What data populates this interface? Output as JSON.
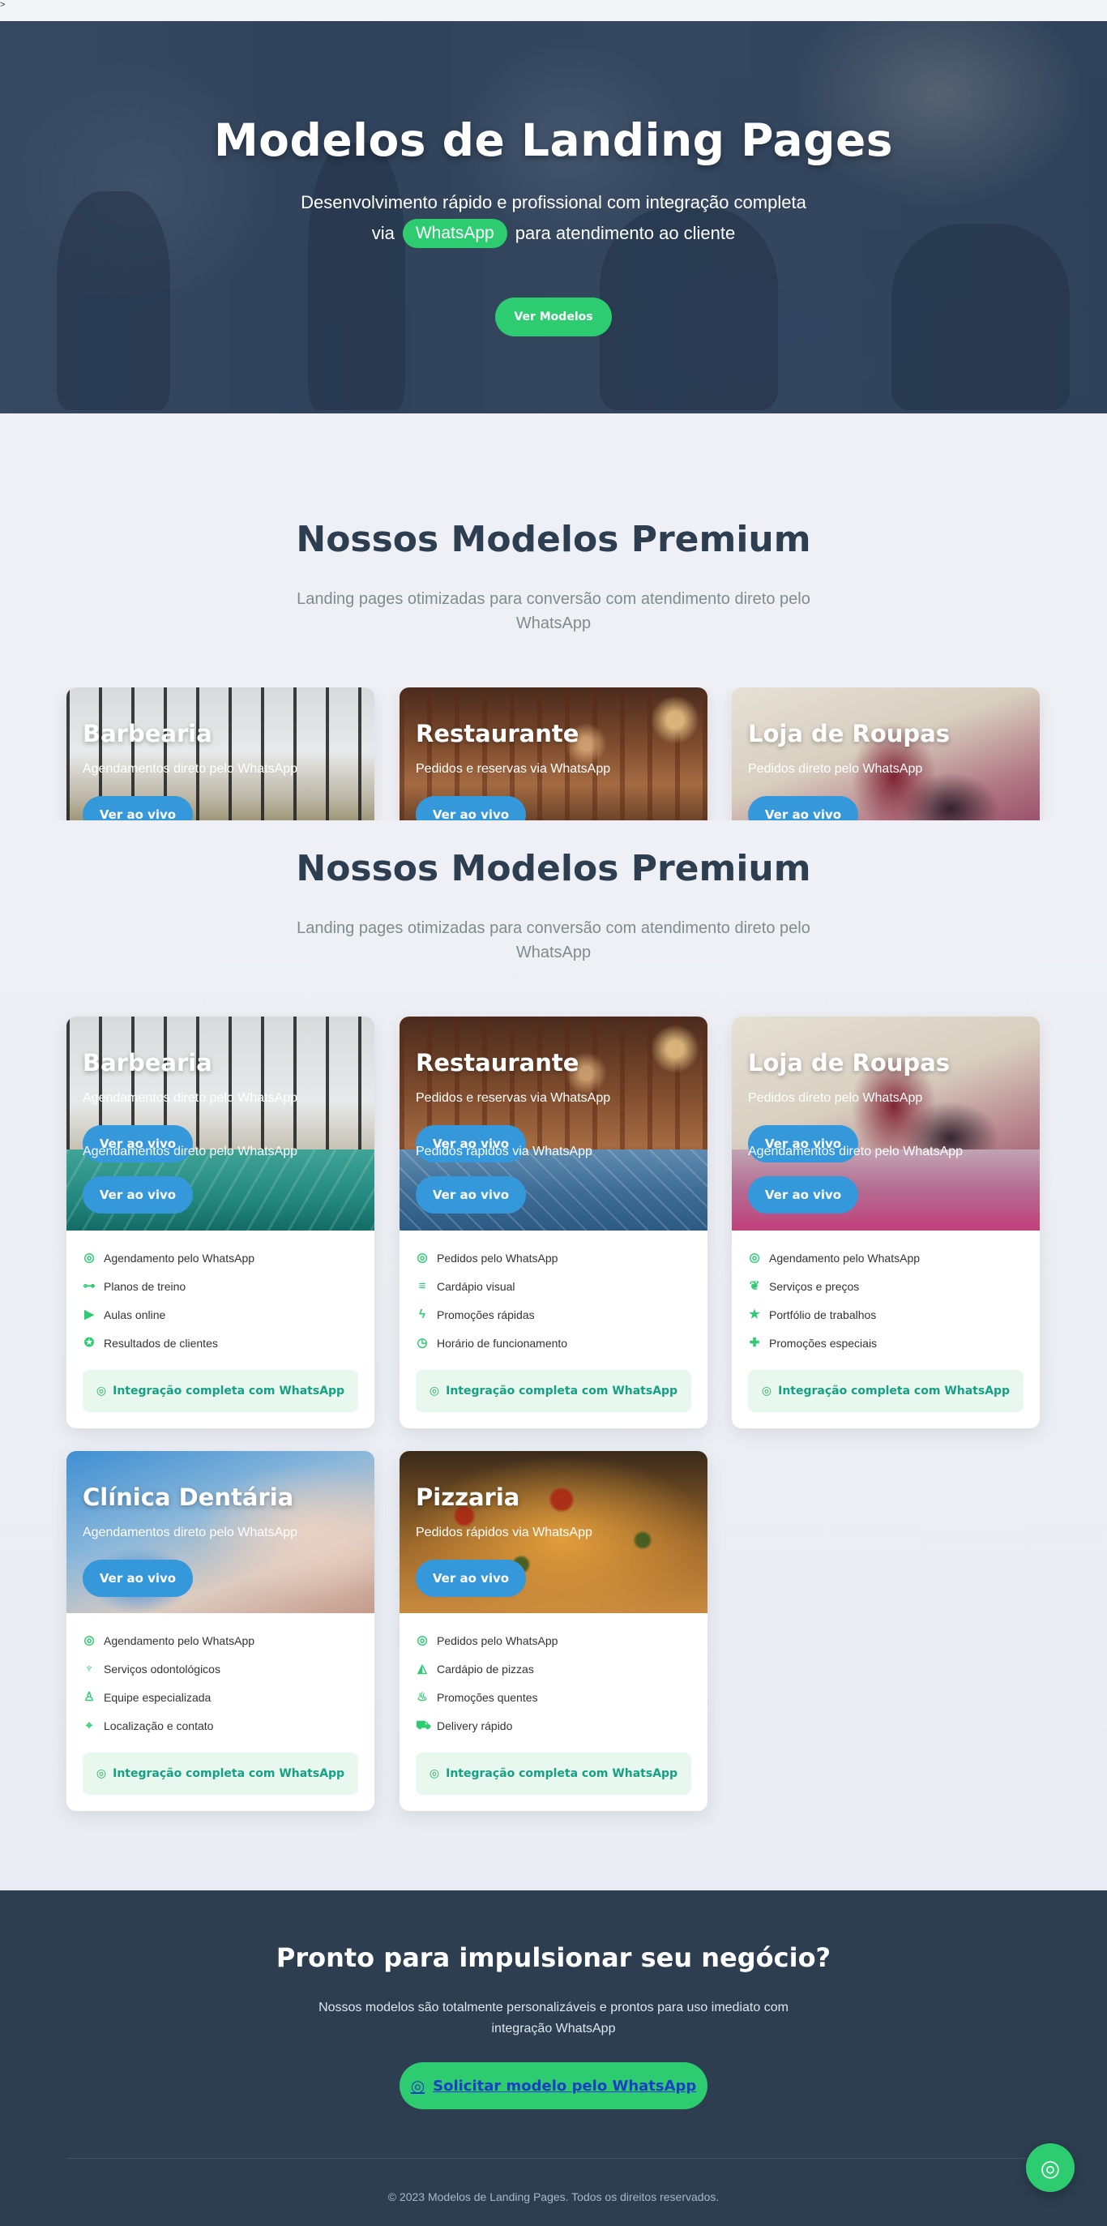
{
  "stray": ">",
  "hero": {
    "title": "Modelos de Landing Pages",
    "subtitle_line1": "Desenvolvimento rápido e profissional com integração completa",
    "subtitle_prefix": "via",
    "subtitle_highlight": "WhatsApp",
    "subtitle_suffix": "para atendimento ao cliente",
    "cta_label": "Ver Modelos"
  },
  "section": {
    "title": "Nossos Modelos Premium",
    "subtitle": "Landing pages otimizadas para conversão com atendimento direto pelo WhatsApp"
  },
  "preview_cards": [
    {
      "title": "Barbearia",
      "tag": "Agendamentos direto pelo WhatsApp",
      "button": "Ver ao vivo"
    },
    {
      "title": "Restaurante",
      "tag": "Pedidos e reservas via WhatsApp",
      "button": "Ver ao vivo"
    },
    {
      "title": "Loja de Roupas",
      "tag": "Pedidos direto pelo WhatsApp",
      "button": "Ver ao vivo"
    }
  ],
  "cards": [
    {
      "title": "Barbearia",
      "tag": "Agendamentos direto pelo WhatsApp",
      "button": "Ver ao vivo",
      "tag2": "Agendamentos direto pelo WhatsApp",
      "button2": "Ver ao vivo",
      "features": [
        {
          "icon": "whatsapp-icon",
          "glyph": "◎",
          "text": "Agendamento pelo WhatsApp"
        },
        {
          "icon": "dumbbell-icon",
          "glyph": "⊶",
          "text": "Planos de treino"
        },
        {
          "icon": "video-icon",
          "glyph": "▶",
          "text": "Aulas online"
        },
        {
          "icon": "medal-icon",
          "glyph": "✪",
          "text": "Resultados de clientes"
        }
      ],
      "integration": "Integração completa com WhatsApp"
    },
    {
      "title": "Restaurante",
      "tag": "Pedidos e reservas via WhatsApp",
      "button": "Ver ao vivo",
      "tag2": "Pedidos rápidos via WhatsApp",
      "button2": "Ver ao vivo",
      "features": [
        {
          "icon": "whatsapp-icon",
          "glyph": "◎",
          "text": "Pedidos pelo WhatsApp"
        },
        {
          "icon": "burger-icon",
          "glyph": "≡",
          "text": "Cardápio visual"
        },
        {
          "icon": "bolt-icon",
          "glyph": "ϟ",
          "text": "Promoções rápidas"
        },
        {
          "icon": "stopwatch-icon",
          "glyph": "◷",
          "text": "Horário de funcionamento"
        }
      ],
      "integration": "Integração completa com WhatsApp"
    },
    {
      "title": "Loja de Roupas",
      "tag": "Pedidos direto pelo WhatsApp",
      "button": "Ver ao vivo",
      "tag2": "Agendamentos direto pelo WhatsApp",
      "button2": "Ver ao vivo",
      "features": [
        {
          "icon": "whatsapp-icon",
          "glyph": "◎",
          "text": "Agendamento pelo WhatsApp"
        },
        {
          "icon": "spa-icon",
          "glyph": "❦",
          "text": "Serviços e preços"
        },
        {
          "icon": "star-icon",
          "glyph": "★",
          "text": "Portfólio de trabalhos"
        },
        {
          "icon": "gift-icon",
          "glyph": "✚",
          "text": "Promoções especiais"
        }
      ],
      "integration": "Integração completa com WhatsApp"
    },
    {
      "title": "Clínica Dentária",
      "tag": "Agendamentos direto pelo WhatsApp",
      "button": "Ver ao vivo",
      "features": [
        {
          "icon": "whatsapp-icon",
          "glyph": "◎",
          "text": "Agendamento pelo WhatsApp"
        },
        {
          "icon": "tooth-icon",
          "glyph": "♆",
          "text": "Serviços odontológicos"
        },
        {
          "icon": "doctor-icon",
          "glyph": "♙",
          "text": "Equipe especializada"
        },
        {
          "icon": "map-pin-icon",
          "glyph": "⌖",
          "text": "Localização e contato"
        }
      ],
      "integration": "Integração completa com WhatsApp"
    },
    {
      "title": "Pizzaria",
      "tag": "Pedidos rápidos via WhatsApp",
      "button": "Ver ao vivo",
      "features": [
        {
          "icon": "whatsapp-icon",
          "glyph": "◎",
          "text": "Pedidos pelo WhatsApp"
        },
        {
          "icon": "pizza-icon",
          "glyph": "◭",
          "text": "Cardápio de pizzas"
        },
        {
          "icon": "fire-icon",
          "glyph": "♨",
          "text": "Promoções quentes"
        },
        {
          "icon": "truck-icon",
          "glyph": "⛟",
          "text": "Delivery rápido"
        }
      ],
      "integration": "Integração completa com WhatsApp"
    }
  ],
  "cta": {
    "title": "Pronto para impulsionar seu negócio?",
    "text": "Nossos modelos são totalmente personalizáveis e prontos para uso imediato com integração WhatsApp",
    "button": "Solicitar modelo pelo WhatsApp"
  },
  "footer": {
    "copyright": "© 2023 Modelos de Landing Pages. Todos os direitos reservados."
  },
  "colors": {
    "accent_green": "#2ecc71",
    "accent_blue": "#3498db",
    "dark_navy": "#2c3e50"
  }
}
